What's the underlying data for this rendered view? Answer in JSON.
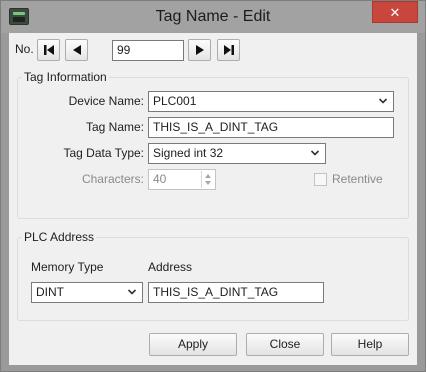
{
  "window": {
    "title": "Tag Name - Edit",
    "close_glyph": "✕"
  },
  "nav": {
    "label": "No.",
    "number": "99"
  },
  "tag_info": {
    "title": "Tag Information",
    "device_name_label": "Device Name:",
    "device_name_value": "PLC001",
    "tag_name_label": "Tag Name:",
    "tag_name_value": "THIS_IS_A_DINT_TAG",
    "tag_data_type_label": "Tag Data Type:",
    "tag_data_type_value": "Signed int 32",
    "characters_label": "Characters:",
    "characters_value": "40",
    "retentive_label": "Retentive"
  },
  "plc_address": {
    "title": "PLC Address",
    "memory_type_label": "Memory Type",
    "memory_type_value": "DINT",
    "address_label": "Address",
    "address_value": "THIS_IS_A_DINT_TAG"
  },
  "buttons": {
    "apply": "Apply",
    "close": "Close",
    "help": "Help"
  },
  "icons": [
    "app-icon",
    "first-record-icon",
    "previous-record-icon",
    "next-record-icon",
    "last-record-icon",
    "chevron-down-icon",
    "spin-up-icon",
    "spin-down-icon"
  ]
}
